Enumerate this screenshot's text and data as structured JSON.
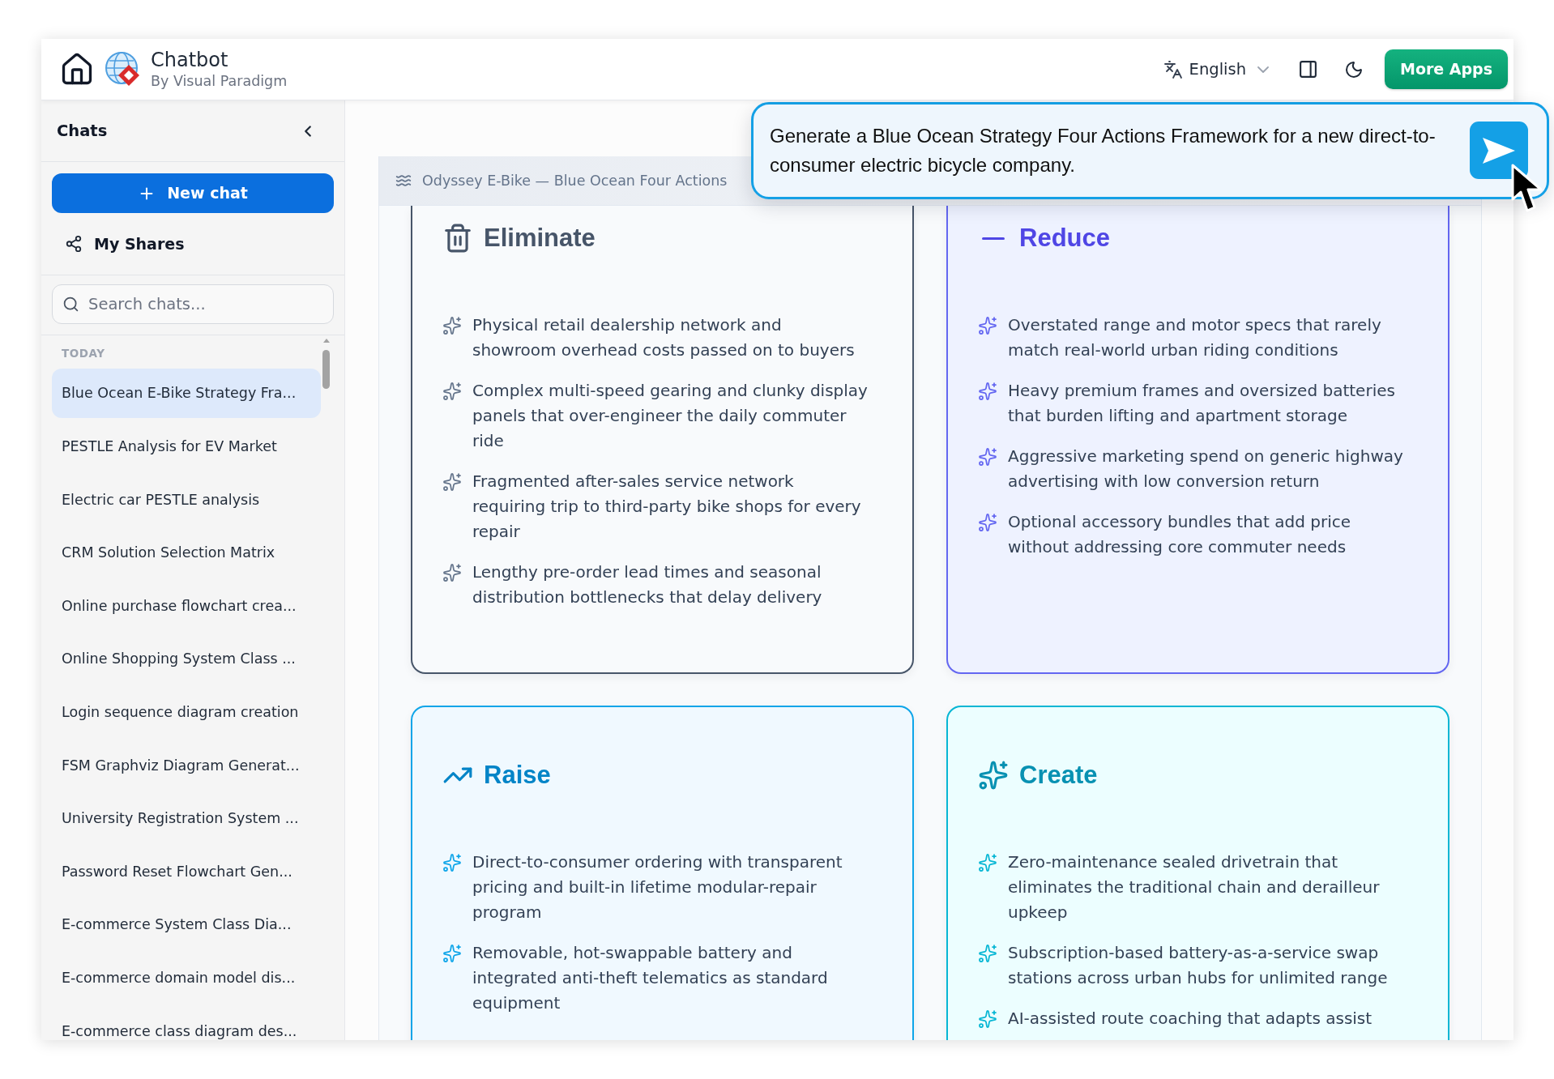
{
  "header": {
    "title": "Chatbot",
    "subtitle": "By Visual Paradigm",
    "language": "English",
    "more_apps": "More Apps"
  },
  "sidebar": {
    "title": "Chats",
    "new_chat": "New chat",
    "my_shares": "My Shares",
    "search": {
      "placeholder": "Search chats..."
    },
    "groups": [
      {
        "label": "TODAY",
        "items": [
          {
            "label": "Blue Ocean E-Bike Strategy Fra...",
            "selected": true
          },
          {
            "label": "PESTLE Analysis for EV Market",
            "selected": false
          },
          {
            "label": "Electric car PESTLE analysis",
            "selected": false
          },
          {
            "label": "CRM Solution Selection Matrix",
            "selected": false
          },
          {
            "label": "Online purchase flowchart crea...",
            "selected": false
          },
          {
            "label": "Online Shopping System Class ...",
            "selected": false
          },
          {
            "label": "Login sequence diagram creation",
            "selected": false
          },
          {
            "label": "FSM Graphviz Diagram Generat...",
            "selected": false
          },
          {
            "label": "University Registration System ...",
            "selected": false
          },
          {
            "label": "Password Reset Flowchart Gen...",
            "selected": false
          },
          {
            "label": "E-commerce System Class Dia...",
            "selected": false
          },
          {
            "label": "E-commerce domain model dis...",
            "selected": false
          },
          {
            "label": "E-commerce class diagram des...",
            "selected": false
          }
        ]
      }
    ]
  },
  "panel": {
    "title": "Odyssey E-Bike — Blue Ocean Four Actions",
    "cards": [
      {
        "kind": "eliminate",
        "title": "Eliminate",
        "items": [
          "Physical retail dealership network and showroom overhead costs passed on to buyers",
          "Complex multi-speed gearing and clunky display panels that over-engineer the daily commuter ride",
          "Fragmented after-sales service network requiring trip to third-party bike shops for every repair",
          "Lengthy pre-order lead times and seasonal distribution bottlenecks that delay delivery"
        ]
      },
      {
        "kind": "reduce",
        "title": "Reduce",
        "items": [
          "Overstated range and motor specs that rarely match real-world urban riding conditions",
          "Heavy premium frames and oversized batteries that burden lifting and apartment storage",
          "Aggressive marketing spend on generic highway advertising with low conversion return",
          "Optional accessory bundles that add price without addressing core commuter needs"
        ]
      },
      {
        "kind": "raise",
        "title": "Raise",
        "items": [
          "Direct-to-consumer ordering with transparent pricing and built-in lifetime modular-repair program",
          "Removable, hot-swappable battery and integrated anti-theft telematics as standard equipment"
        ]
      },
      {
        "kind": "create",
        "title": "Create",
        "items": [
          "Zero-maintenance sealed drivetrain that eliminates the traditional chain and derailleur upkeep",
          "Subscription-based battery-as-a-service swap stations across urban hubs for unlimited range",
          "AI-assisted route coaching that adapts assist"
        ]
      }
    ]
  },
  "prompt": {
    "value": "Generate a Blue Ocean Strategy Four Actions Framework for a new direct-to-consumer electric bicycle company."
  }
}
